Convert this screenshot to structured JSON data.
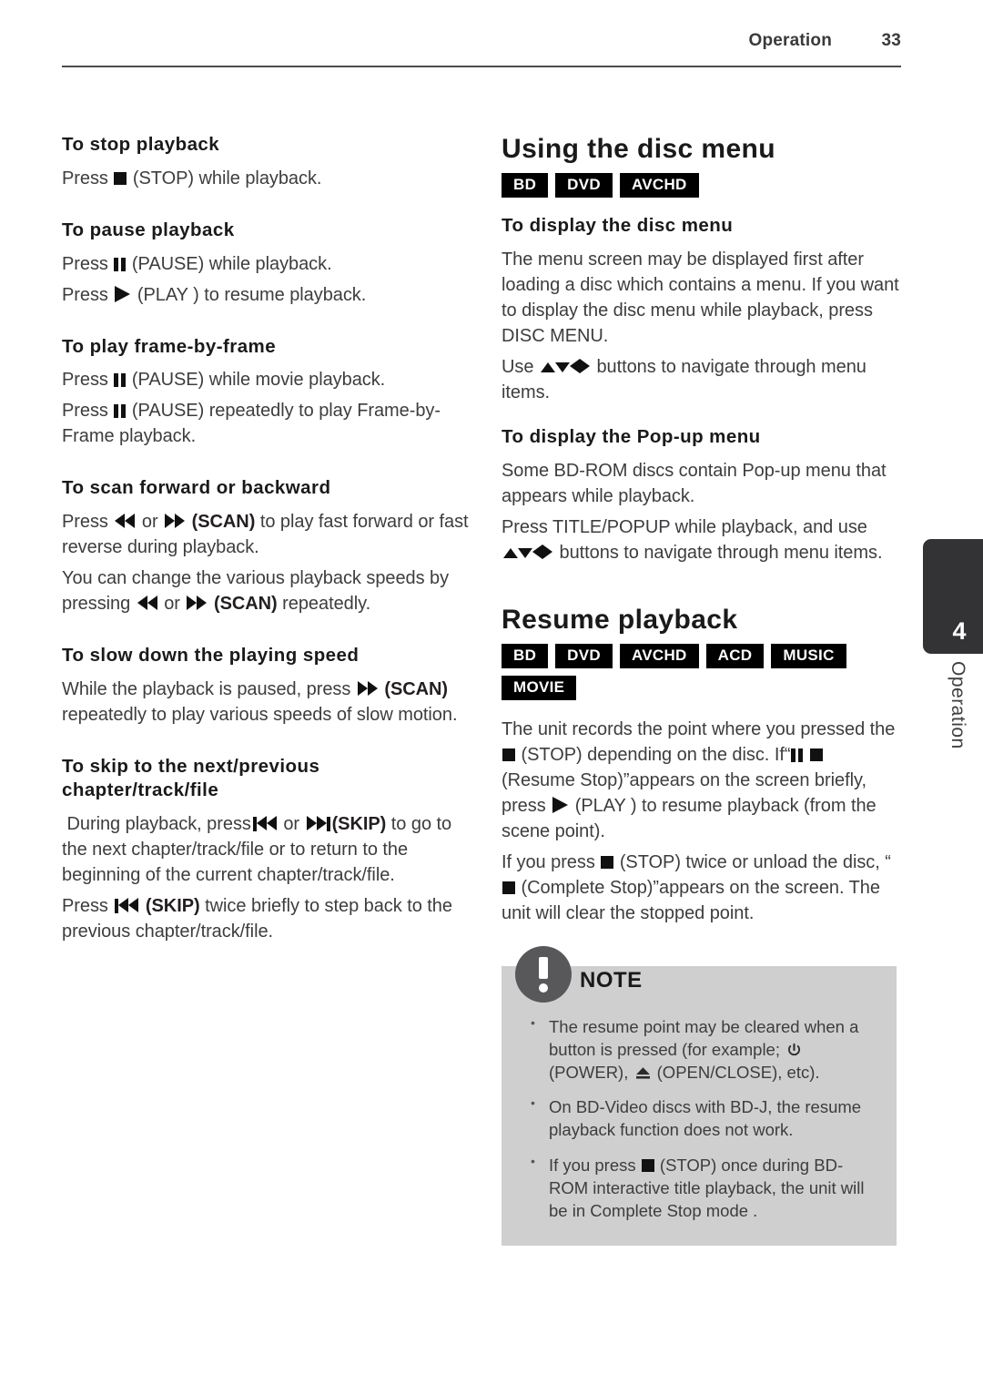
{
  "header": {
    "chapter": "Operation",
    "page_number": "33"
  },
  "side_tab": {
    "number": "4",
    "label": "Operation"
  },
  "left_column": {
    "sections": [
      {
        "heading": "To stop playback",
        "lines": [
          "Press ■ (STOP) while playback."
        ]
      },
      {
        "heading": "To pause playback",
        "lines": [
          "Press ❚❚ (PAUSE) while playback.",
          "Press ▶ (PLAY ) to resume playback."
        ]
      },
      {
        "heading": "To play frame-by-frame",
        "lines": [
          "Press ❚❚ (PAUSE) while movie playback.",
          "Press ❚❚ (PAUSE) repeatedly to play Frame-by-Frame playback."
        ]
      },
      {
        "heading": "To scan forward or backward",
        "lines": [
          "Press ◀◀ or ▶▶ (SCAN) to play fast forward or fast reverse during playback.",
          "You can change the various playback speeds by pressing ◀◀ or ▶▶ (SCAN) repeatedly."
        ]
      },
      {
        "heading": "To slow down the playing speed",
        "lines": [
          "While the playback is paused, press ▶▶ (SCAN) repeatedly to play various speeds of slow motion."
        ]
      },
      {
        "heading": "To skip to the next/previous chapter/track/file",
        "lines": [
          "During playback, press ⏮ or ⏭(SKIP) to go to the next chapter/track/file or to return to the beginning of the current chapter/track/file.",
          "Press ⏮ (SKIP) twice briefly to step back to the previous chapter/track/file."
        ]
      }
    ],
    "fragments": {
      "press": "Press",
      "stop_label": "(STOP) while playback.",
      "pause_label": "(PAUSE) while playback.",
      "play_label": "(PLAY ) to resume playback.",
      "pause_movie_label": "(PAUSE) while movie playback.",
      "pause_repeat_label": "(PAUSE) repeatedly to play Frame-by-Frame playback.",
      "or": "or",
      "scan_bold": "(SCAN)",
      "scan_tail": "to play fast forward or fast reverse during playback.",
      "scan_change_head": "You can change the various playback speeds by pressing",
      "scan_change_tail": "repeatedly.",
      "slow_head": "While the playback is paused, press",
      "slow_tail": "repeatedly to play various speeds of slow motion.",
      "skip_head": "During playback, press",
      "skip_bold": "(SKIP)",
      "skip_tail": "to go to the next chapter/track/file or to return to the beginning of the current chapter/track/file.",
      "skip_twice_head": "Press",
      "skip_twice_tail": "twice briefly to step back to the previous chapter/track/file."
    }
  },
  "right_column": {
    "disc_menu": {
      "title": "Using the disc menu",
      "badges": [
        "BD",
        "DVD",
        "AVCHD"
      ],
      "display_disc_menu": {
        "heading": "To display the disc menu",
        "paragraph_1": "The menu screen may be displayed first after loading a disc which contains a menu. If you want to display the disc menu while playback, press DISC MENU.",
        "paragraph_2_head": "Use",
        "paragraph_2_tail": "buttons to navigate through menu items."
      },
      "display_popup_menu": {
        "heading": "To display the Pop-up menu",
        "paragraph_1": "Some BD-ROM discs contain Pop-up menu that appears while playback.",
        "paragraph_2_head": "Press TITLE/POPUP while playback, and use",
        "paragraph_2_tail": "buttons to navigate through menu items."
      }
    },
    "resume": {
      "title": "Resume playback",
      "badges": [
        "BD",
        "DVD",
        "AVCHD",
        "ACD",
        "MUSIC",
        "MOVIE"
      ],
      "p1_a": "The unit records the point where you pressed the",
      "p1_b": "(STOP) depending on the disc.",
      "p1_c": "If“",
      "p1_d": "(Resume Stop)”appears on the screen briefly, press",
      "p1_e": "(PLAY ) to resume playback (from the scene point).",
      "p2_a": "If you press",
      "p2_b": "(STOP) twice or unload the disc,",
      "p2_c": "“",
      "p2_d": "(Complete Stop)”appears on the screen. The unit will clear the stopped point."
    },
    "note": {
      "title": "NOTE",
      "items": [
        {
          "text_a": "The resume point may be cleared when a button is pressed (for example;",
          "text_b": "(POWER),",
          "text_c": "(OPEN/CLOSE), etc)."
        },
        {
          "text_a": "On BD-Video discs with BD-J, the resume playback function does not work."
        },
        {
          "text_a": "If you press",
          "text_b": "(STOP) once during BD-ROM interactive title playback, the unit will be in Complete Stop mode ."
        }
      ]
    }
  },
  "colors": {
    "text": "#3d3d3f",
    "heading": "#1a1a1a",
    "badge_bg": "#000000",
    "note_bg": "#cfcfcf",
    "note_circle": "#58585a",
    "tab_bg": "#333335"
  }
}
